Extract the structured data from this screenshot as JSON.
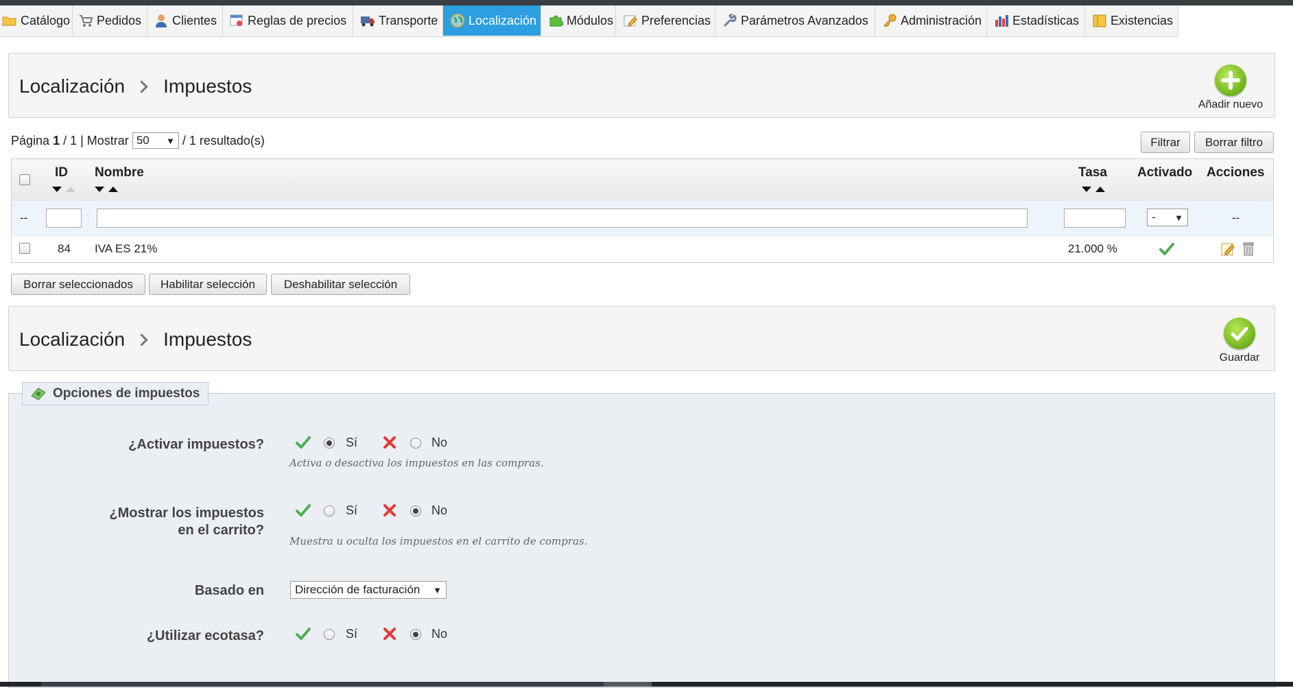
{
  "menu": {
    "tabs": [
      {
        "label": "Catálogo",
        "icon": "folder-icon"
      },
      {
        "label": "Pedidos",
        "icon": "cart-icon"
      },
      {
        "label": "Clientes",
        "icon": "user-icon"
      },
      {
        "label": "Reglas de precios",
        "icon": "price-rules-icon"
      },
      {
        "label": "Transporte",
        "icon": "truck-icon"
      },
      {
        "label": "Localización",
        "icon": "globe-icon",
        "active": true
      },
      {
        "label": "Módulos",
        "icon": "puzzle-icon"
      },
      {
        "label": "Preferencias",
        "icon": "preferences-icon"
      },
      {
        "label": "Parámetros Avanzados",
        "icon": "wrench-icon"
      },
      {
        "label": "Administración",
        "icon": "key-icon"
      },
      {
        "label": "Estadísticas",
        "icon": "bar-chart-icon"
      },
      {
        "label": "Existencias",
        "icon": "stock-icon"
      }
    ]
  },
  "header1": {
    "crumb1": "Localización",
    "crumb2": "Impuestos",
    "action_label": "Añadir nuevo"
  },
  "list": {
    "page_label": "Página",
    "page_current": "1",
    "page_total": "/ 1 | Mostrar",
    "per_page": "50",
    "results": "/ 1 resultado(s)",
    "filter_button": "Filtrar",
    "reset_filter_button": "Borrar filtro",
    "columns": {
      "id": "ID",
      "name": "Nombre",
      "rate": "Tasa",
      "active": "Activado",
      "actions": "Acciones"
    },
    "filter_placeholder_left": "--",
    "filter_active_value": "-",
    "filter_actions": "--",
    "rows": [
      {
        "id": "84",
        "name": "IVA ES 21%",
        "rate": "21.000 %",
        "active": true
      }
    ],
    "bulk": {
      "delete": "Borrar seleccionados",
      "enable": "Habilitar selección",
      "disable": "Deshabilitar selección"
    }
  },
  "header2": {
    "crumb1": "Localización",
    "crumb2": "Impuestos",
    "action_label": "Guardar"
  },
  "options": {
    "legend": "Opciones de impuestos",
    "yes": "Sí",
    "no": "No",
    "fields": [
      {
        "label": "¿Activar impuestos?",
        "value": "yes",
        "hint": "Activa o desactiva los impuestos en las compras."
      },
      {
        "label": "¿Mostrar los impuestos en el carrito?",
        "value": "no",
        "hint": "Muestra u oculta los impuestos en el carrito de compras."
      },
      {
        "label": "Basado en",
        "select_value": "Dirección de facturación"
      },
      {
        "label": "¿Utilizar ecotasa?",
        "value": "no"
      }
    ]
  },
  "colors": {
    "active_tab": "#2d9ee0",
    "add_button": "#6fb31d",
    "fieldset_bg": "#ebeef3",
    "check_green": "#4caf50",
    "cross_red": "#e53935"
  }
}
